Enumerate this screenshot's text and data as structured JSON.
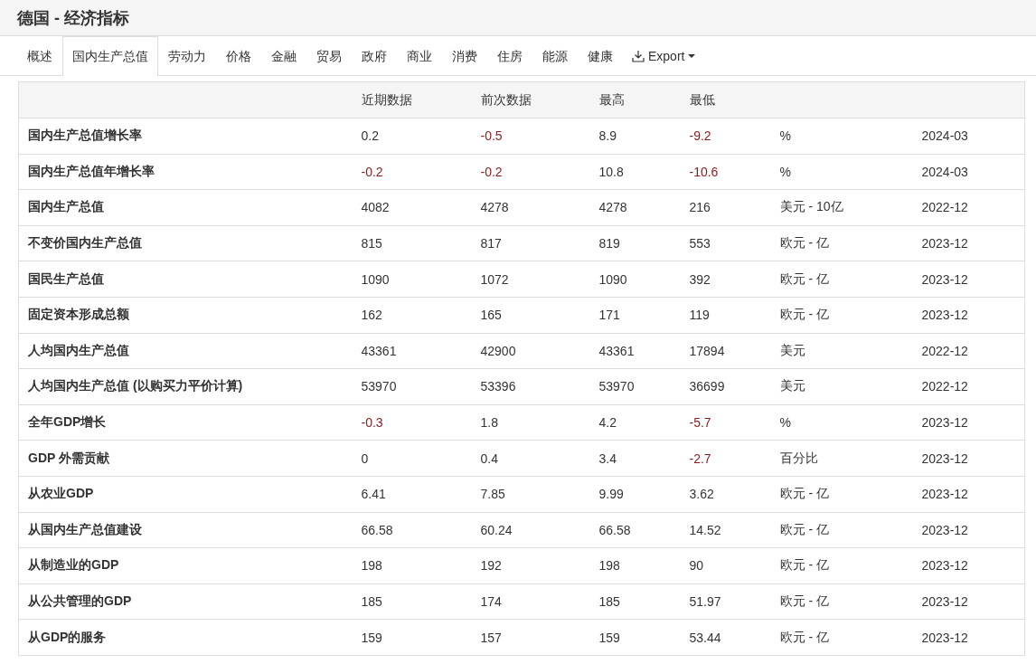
{
  "title": "德国 - 经济指标",
  "tabs": [
    {
      "label": "概述",
      "selected": false
    },
    {
      "label": "国内生产总值",
      "selected": true
    },
    {
      "label": "劳动力",
      "selected": false
    },
    {
      "label": "价格",
      "selected": false
    },
    {
      "label": "金融",
      "selected": false
    },
    {
      "label": "贸易",
      "selected": false
    },
    {
      "label": "政府",
      "selected": false
    },
    {
      "label": "商业",
      "selected": false
    },
    {
      "label": "消费",
      "selected": false
    },
    {
      "label": "住房",
      "selected": false
    },
    {
      "label": "能源",
      "selected": false
    },
    {
      "label": "健康",
      "selected": false
    }
  ],
  "export": {
    "label": "Export"
  },
  "table": {
    "columns": [
      "近期数据",
      "前次数据",
      "最高",
      "最低"
    ],
    "rows": [
      {
        "name": "国内生产总值增长率",
        "values": [
          {
            "text": "0.2",
            "negative": false
          },
          {
            "text": "-0.5",
            "negative": true
          },
          {
            "text": "8.9",
            "negative": false
          },
          {
            "text": "-9.2",
            "negative": true
          }
        ],
        "unit": "%",
        "date": "2024-03"
      },
      {
        "name": "国内生产总值年增长率",
        "values": [
          {
            "text": "-0.2",
            "negative": true
          },
          {
            "text": "-0.2",
            "negative": true
          },
          {
            "text": "10.8",
            "negative": false
          },
          {
            "text": "-10.6",
            "negative": true
          }
        ],
        "unit": "%",
        "date": "2024-03"
      },
      {
        "name": "国内生产总值",
        "values": [
          {
            "text": "4082",
            "negative": false
          },
          {
            "text": "4278",
            "negative": false
          },
          {
            "text": "4278",
            "negative": false
          },
          {
            "text": "216",
            "negative": false
          }
        ],
        "unit": "美元 - 10亿",
        "date": "2022-12"
      },
      {
        "name": "不变价国内生产总值",
        "values": [
          {
            "text": "815",
            "negative": false
          },
          {
            "text": "817",
            "negative": false
          },
          {
            "text": "819",
            "negative": false
          },
          {
            "text": "553",
            "negative": false
          }
        ],
        "unit": "欧元 - 亿",
        "date": "2023-12"
      },
      {
        "name": "国民生产总值",
        "values": [
          {
            "text": "1090",
            "negative": false
          },
          {
            "text": "1072",
            "negative": false
          },
          {
            "text": "1090",
            "negative": false
          },
          {
            "text": "392",
            "negative": false
          }
        ],
        "unit": "欧元 - 亿",
        "date": "2023-12"
      },
      {
        "name": "固定资本形成总额",
        "values": [
          {
            "text": "162",
            "negative": false
          },
          {
            "text": "165",
            "negative": false
          },
          {
            "text": "171",
            "negative": false
          },
          {
            "text": "119",
            "negative": false
          }
        ],
        "unit": "欧元 - 亿",
        "date": "2023-12"
      },
      {
        "name": "人均国内生产总值",
        "values": [
          {
            "text": "43361",
            "negative": false
          },
          {
            "text": "42900",
            "negative": false
          },
          {
            "text": "43361",
            "negative": false
          },
          {
            "text": "17894",
            "negative": false
          }
        ],
        "unit": "美元",
        "date": "2022-12"
      },
      {
        "name": "人均国内生产总值 (以购买力平价计算)",
        "values": [
          {
            "text": "53970",
            "negative": false
          },
          {
            "text": "53396",
            "negative": false
          },
          {
            "text": "53970",
            "negative": false
          },
          {
            "text": "36699",
            "negative": false
          }
        ],
        "unit": "美元",
        "date": "2022-12"
      },
      {
        "name": "全年GDP增长",
        "values": [
          {
            "text": "-0.3",
            "negative": true
          },
          {
            "text": "1.8",
            "negative": false
          },
          {
            "text": "4.2",
            "negative": false
          },
          {
            "text": "-5.7",
            "negative": true
          }
        ],
        "unit": "%",
        "date": "2023-12"
      },
      {
        "name": "GDP 外需贡献",
        "values": [
          {
            "text": "0",
            "negative": false
          },
          {
            "text": "0.4",
            "negative": false
          },
          {
            "text": "3.4",
            "negative": false
          },
          {
            "text": "-2.7",
            "negative": true
          }
        ],
        "unit": "百分比",
        "date": "2023-12"
      },
      {
        "name": "从农业GDP",
        "values": [
          {
            "text": "6.41",
            "negative": false
          },
          {
            "text": "7.85",
            "negative": false
          },
          {
            "text": "9.99",
            "negative": false
          },
          {
            "text": "3.62",
            "negative": false
          }
        ],
        "unit": "欧元 - 亿",
        "date": "2023-12"
      },
      {
        "name": "从国内生产总值建设",
        "values": [
          {
            "text": "66.58",
            "negative": false
          },
          {
            "text": "60.24",
            "negative": false
          },
          {
            "text": "66.58",
            "negative": false
          },
          {
            "text": "14.52",
            "negative": false
          }
        ],
        "unit": "欧元 - 亿",
        "date": "2023-12"
      },
      {
        "name": "从制造业的GDP",
        "values": [
          {
            "text": "198",
            "negative": false
          },
          {
            "text": "192",
            "negative": false
          },
          {
            "text": "198",
            "negative": false
          },
          {
            "text": "90",
            "negative": false
          }
        ],
        "unit": "欧元 - 亿",
        "date": "2023-12"
      },
      {
        "name": "从公共管理的GDP",
        "values": [
          {
            "text": "185",
            "negative": false
          },
          {
            "text": "174",
            "negative": false
          },
          {
            "text": "185",
            "negative": false
          },
          {
            "text": "51.97",
            "negative": false
          }
        ],
        "unit": "欧元 - 亿",
        "date": "2023-12"
      },
      {
        "name": "从GDP的服务",
        "values": [
          {
            "text": "159",
            "negative": false
          },
          {
            "text": "157",
            "negative": false
          },
          {
            "text": "159",
            "negative": false
          },
          {
            "text": "53.44",
            "negative": false
          }
        ],
        "unit": "欧元 - 亿",
        "date": "2023-12"
      }
    ]
  }
}
